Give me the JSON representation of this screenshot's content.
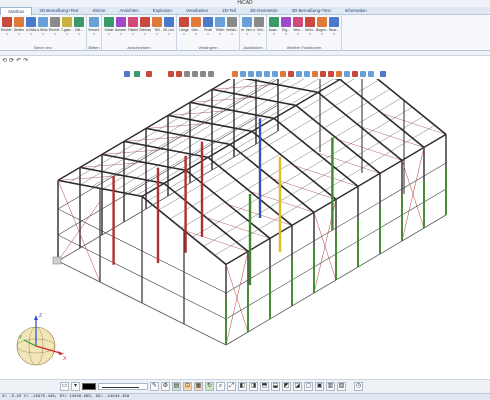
{
  "app": {
    "title": "HiCAD"
  },
  "tabs": [
    {
      "label": "Startbox",
      "active": true
    },
    {
      "label": "2D-Bemaßung+Text"
    },
    {
      "label": "Skizze"
    },
    {
      "label": "Ansichten"
    },
    {
      "label": "Explosion"
    },
    {
      "label": "Verarbeiten"
    },
    {
      "label": "2D-Teil"
    },
    {
      "label": "2D-Geometrie"
    },
    {
      "label": "3D-Bemaßung+Text"
    },
    {
      "label": "Information"
    }
  ],
  "ribbon": {
    "groups": [
      {
        "label": "Blech neu",
        "buttons": [
          "Rechtt...",
          "Stellen",
          "a.Stütz",
          "a.Stütz...",
          "Rechtt...",
          "T-glas...",
          "Gitt..."
        ]
      },
      {
        "label": "Blitten",
        "buttons": [
          "Verschl..."
        ]
      },
      {
        "label": "Anschneiden",
        "buttons": [
          "Kante",
          "Aussen...",
          "Fläche",
          "Gehrung",
          "Teil",
          "2D-Lini..."
        ]
      },
      {
        "label": "Verlängern",
        "buttons": [
          "Länge",
          "Ges...",
          "Profil",
          "Teilen",
          "Verlän..."
        ]
      },
      {
        "label": "Ausklinken",
        "buttons": [
          "m. Verl...",
          "o. Verl..."
        ]
      },
      {
        "label": "Weitere Funktionen",
        "buttons": [
          "Ausn...",
          "Erg...",
          "Verz...",
          "Verbi...",
          "Bogen...",
          "Bear..."
        ]
      }
    ]
  },
  "colors": {
    "accent": "#2a4a7a",
    "steel": "#2b2b2b",
    "column_green": "#3e8a2a",
    "column_red": "#b03030",
    "column_blue": "#3a4fb0",
    "column_yellow": "#d6c21a"
  },
  "status": {
    "text": "X= -5.43  Y= -15975.448, DY= 14346.685, DZ= -14044.458"
  },
  "gizmo": {
    "x_label": "X",
    "y_label": "Y",
    "z_label": "Z"
  },
  "icons": {
    "qat": [
      "open-icon",
      "save-icon",
      "undo-icon",
      "redo-icon"
    ],
    "bottom": [
      "folder-icon",
      "color-swatch",
      "line-style",
      "pen-icon",
      "settings-icon",
      "zoom-icon",
      "refresh-icon"
    ]
  }
}
